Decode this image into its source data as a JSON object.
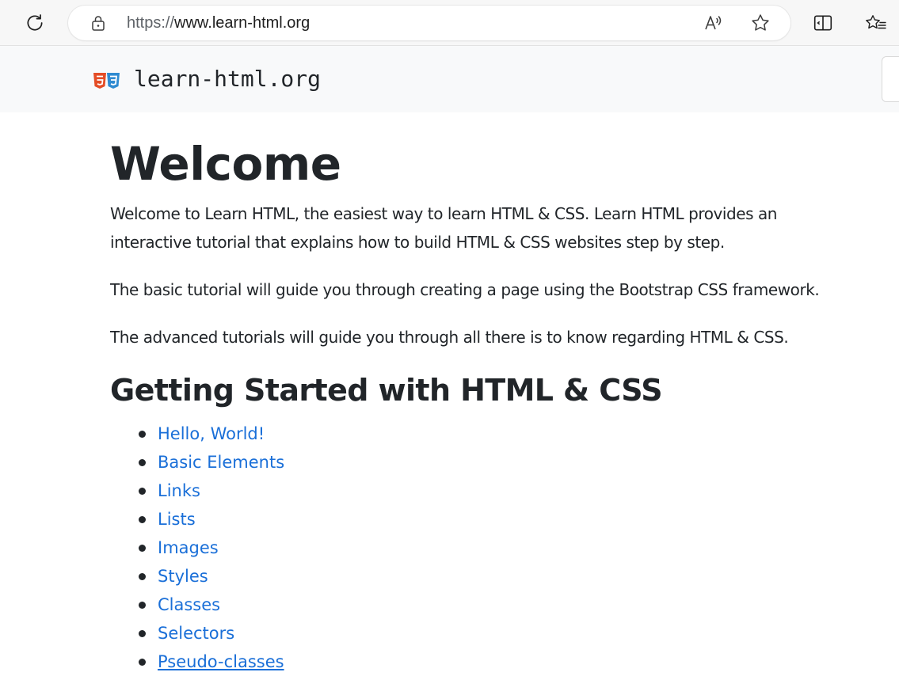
{
  "browser": {
    "url_scheme": "https://",
    "url_host": "www.learn-html.org",
    "icons": {
      "reload": "reload-icon",
      "lock": "lock-icon",
      "read_aloud": "read-aloud-icon",
      "favorite": "star-icon",
      "split_screen": "split-screen-icon",
      "favorites_list": "favorites-list-icon"
    }
  },
  "site": {
    "brand": "learn-html.org",
    "logo_icon": "html5-css3-logo-icon"
  },
  "main": {
    "title": "Welcome",
    "intro_line_1": "Welcome to Learn HTML, the easiest way to learn HTML & CSS. Learn HTML provides an",
    "intro_line_2": "interactive tutorial that explains how to build HTML & CSS websites step by step.",
    "basic_paragraph": "The basic tutorial will guide you through creating a page using the Bootstrap CSS framework.",
    "advanced_paragraph": "The advanced tutorials will guide you through all there is to know regarding HTML & CSS.",
    "section_heading": "Getting Started with HTML & CSS",
    "tutorials": [
      "Hello, World!",
      "Basic Elements",
      "Links",
      "Lists",
      "Images",
      "Styles",
      "Classes",
      "Selectors",
      "Pseudo-classes"
    ]
  },
  "colors": {
    "link": "#1a6fd8",
    "text": "#212529",
    "navbar_bg": "#f8f9fa",
    "toolbar_bg": "#f7f7f7"
  }
}
